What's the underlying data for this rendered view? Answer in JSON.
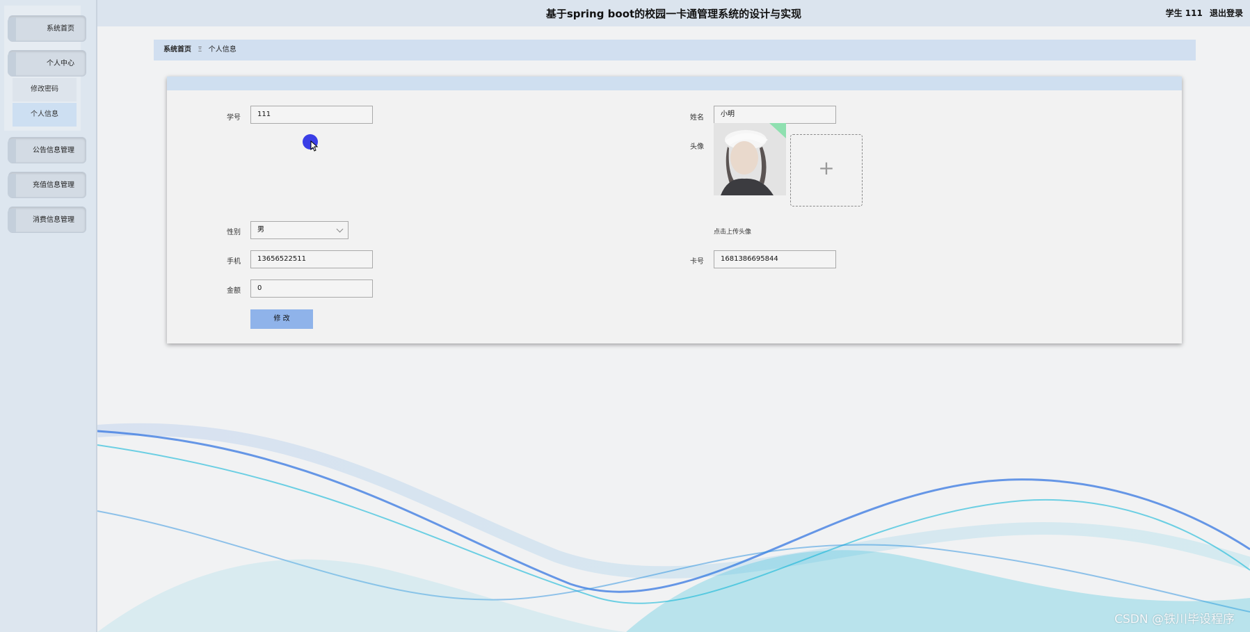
{
  "app_title": "基于spring boot的校园一卡通管理系统的设计与实现",
  "header": {
    "user_label": "学生 111",
    "logout_label": "退出登录"
  },
  "sidebar": {
    "home": "系统首页",
    "personal_center": "个人中心",
    "change_password": "修改密码",
    "personal_info": "个人信息",
    "notice_mgmt": "公告信息管理",
    "recharge_mgmt": "充值信息管理",
    "consume_mgmt": "消费信息管理"
  },
  "breadcrumb": {
    "home": "系统首页",
    "separator": "Ξ",
    "current": "个人信息"
  },
  "form": {
    "student_id_label": "学号",
    "student_id_value": "111",
    "name_label": "姓名",
    "name_value": "小明",
    "avatar_label": "头像",
    "upload_hint": "点击上传头像",
    "gender_label": "性别",
    "gender_value": "男",
    "phone_label": "手机",
    "phone_value": "13656522511",
    "card_label": "卡号",
    "card_value": "1681386695844",
    "balance_label": "金额",
    "balance_value": "0",
    "submit_label": "修 改",
    "upload_plus": "+"
  },
  "watermark": "CSDN @铁川毕设程序",
  "colors": {
    "accent": "#8fb3ea",
    "breadcrumb_bg": "#d1dff0",
    "header_bg": "#dbe4ee",
    "wave_blue": "#2a6fe0",
    "wave_cyan": "#14b8d8"
  }
}
